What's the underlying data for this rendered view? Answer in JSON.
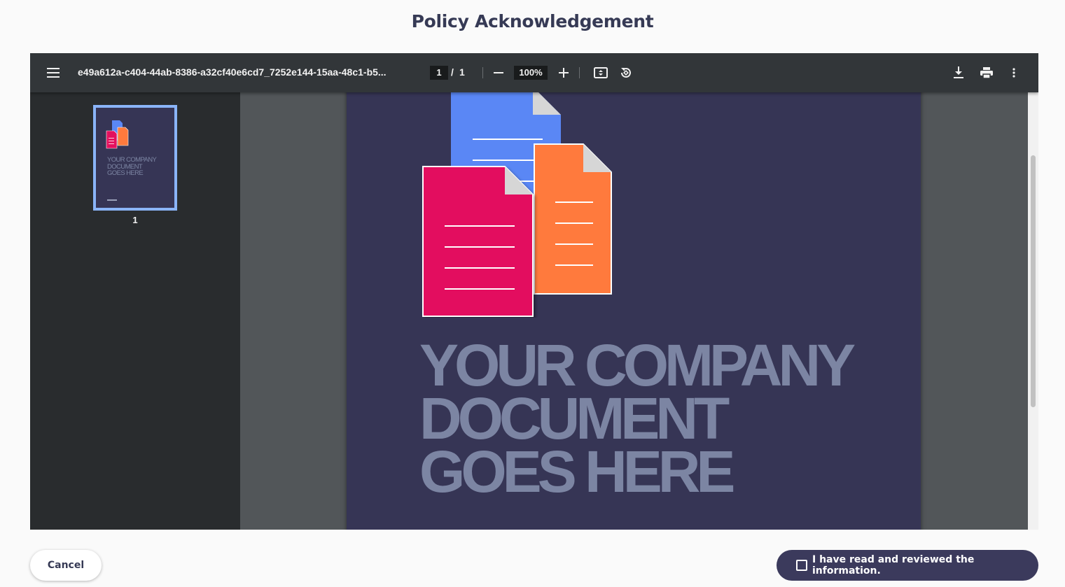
{
  "page": {
    "title": "Policy Acknowledgement"
  },
  "viewer": {
    "filename": "e49a612a-c404-44ab-8386-a32cf40e6cd7_7252e144-15aa-48c1-b5...",
    "current_page": "1",
    "page_separator": "/",
    "total_pages": "1",
    "zoom": "100%",
    "icons": {
      "menu": "menu-icon",
      "zoom_out": "minus-icon",
      "zoom_in": "plus-icon",
      "fit": "fit-to-page-icon",
      "rotate": "rotate-icon",
      "download": "download-icon",
      "print": "print-icon",
      "more": "more-vertical-icon"
    }
  },
  "sidebar": {
    "thumbnail_text": [
      "YOUR COMPANY",
      "DOCUMENT",
      "GOES HERE"
    ],
    "thumbnail_page_number": "1"
  },
  "document": {
    "headline_lines": [
      "YOUR COMPANY",
      "DOCUMENT",
      "GOES HERE"
    ],
    "colors": {
      "background": "#363555",
      "headline": "#7c85a3",
      "doc_blue": "#5a87f5",
      "doc_orange": "#ff7a3d",
      "doc_pink": "#e3105e"
    }
  },
  "footer": {
    "cancel_label": "Cancel",
    "acknowledge_label": "I have read and reviewed the information.",
    "acknowledge_checked": false
  },
  "colors": {
    "accent": "#3b3a5c",
    "toolbar": "#323639",
    "thumbnail_border": "#8ab4f8"
  }
}
